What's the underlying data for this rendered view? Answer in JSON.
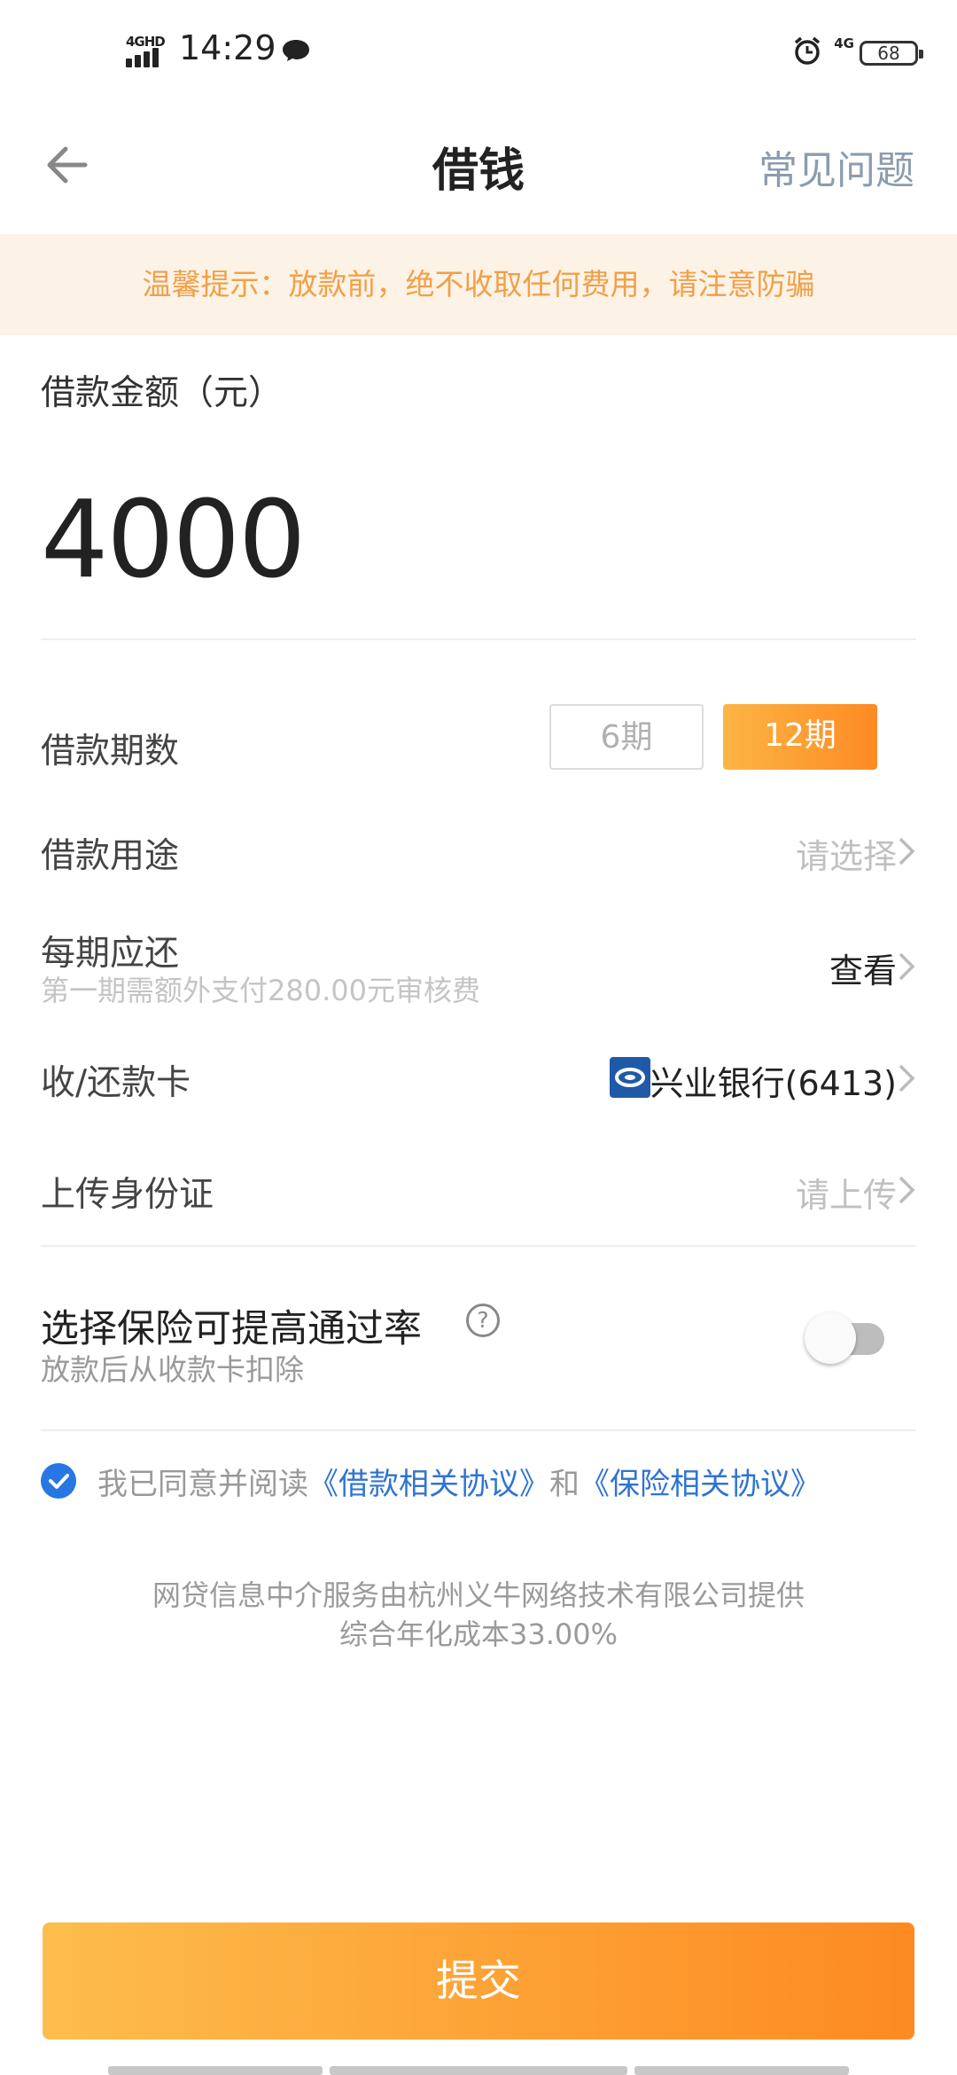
{
  "status_bar": {
    "network": "4GHD",
    "time": "14:29",
    "network_right": "4G",
    "battery": "68"
  },
  "header": {
    "title": "借钱",
    "faq_label": "常见问题"
  },
  "notice": "温馨提示：放款前，绝不收取任何费用，请注意防骗",
  "amount": {
    "label": "借款金额（元）",
    "value": "4000"
  },
  "term": {
    "label": "借款期数",
    "options": [
      "6期",
      "12期"
    ],
    "selected": "12期"
  },
  "purpose": {
    "label": "借款用途",
    "value": "请选择"
  },
  "installment": {
    "label": "每期应还",
    "sub": "第一期需额外支付280.00元审核费",
    "action": "查看"
  },
  "card": {
    "label": "收/还款卡",
    "bank": "兴业银行(6413)"
  },
  "id_upload": {
    "label": "上传身份证",
    "value": "请上传"
  },
  "insurance": {
    "title": "选择保险可提高通过率",
    "help": "?",
    "sub": "放款后从收款卡扣除",
    "enabled": false
  },
  "agreement": {
    "checked": true,
    "prefix": "我已同意并阅读",
    "link1": "《借款相关协议》",
    "and": "和",
    "link2": "《保险相关协议》"
  },
  "footer": {
    "line1": "网贷信息中介服务由杭州义牛网络技术有限公司提供",
    "line2": "综合年化成本33.00%"
  },
  "submit_label": "提交",
  "colors": {
    "accent": "#fd8a24",
    "link": "#2f74d0",
    "notice_bg": "#fdf2e6",
    "notice_text": "#f0a048"
  }
}
